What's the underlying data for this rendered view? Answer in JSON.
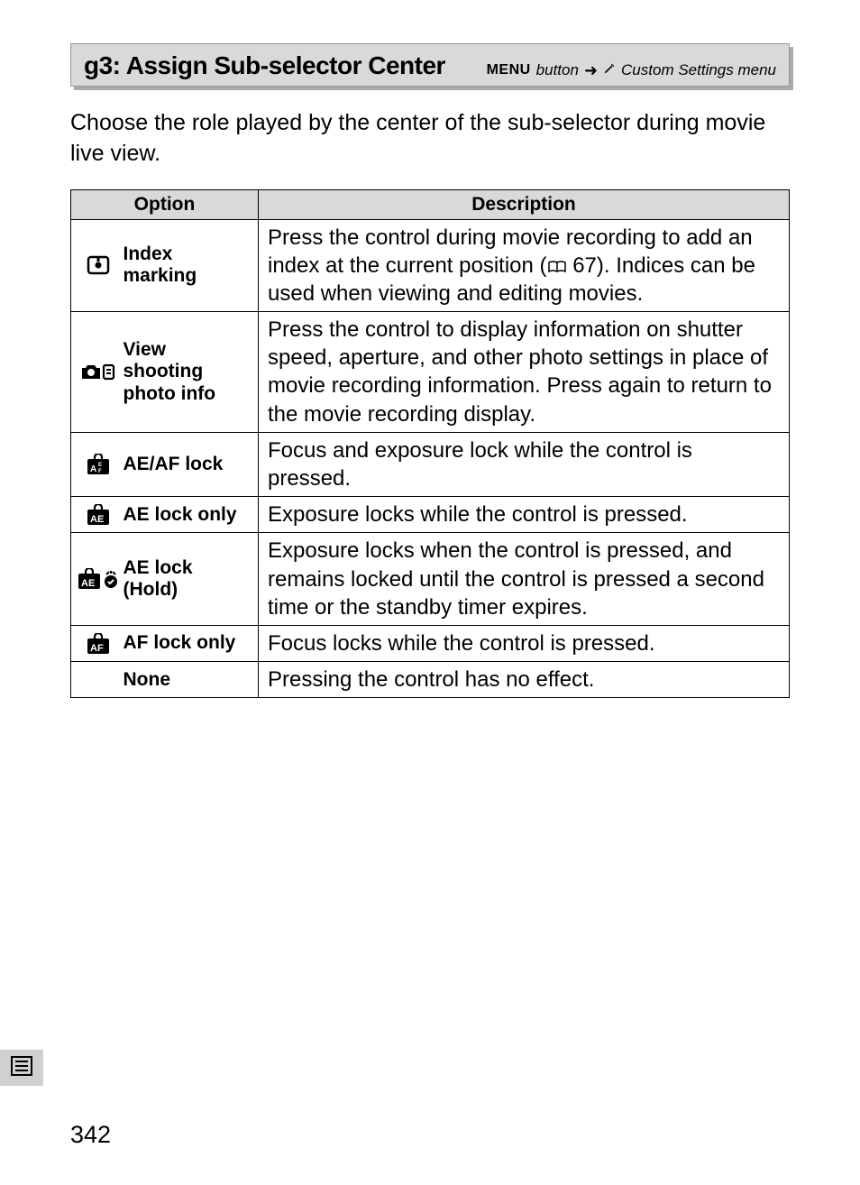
{
  "header": {
    "title": "g3: Assign Sub-selector Center",
    "menu_label": "MENU",
    "button_label": "button",
    "arrow": "➜",
    "menu_name": "Custom Settings menu"
  },
  "intro": "Choose the role played by the center of the sub-selector during movie live view.",
  "table": {
    "col_option": "Option",
    "col_description": "Description",
    "rows": [
      {
        "icon": "index-marking",
        "label": "Index marking",
        "desc_pre": "Press the control during movie recording to add an index at the current position (",
        "desc_ref": "67",
        "desc_post": ").  Indices can be used when viewing and editing movies."
      },
      {
        "icon": "camera-info",
        "label": "View shooting photo info",
        "desc": "Press the control to display information on shutter speed, aperture, and other photo settings in place of movie recording information.  Press again to return to the movie recording display."
      },
      {
        "icon": "ae-af-lock",
        "label": "AE/AF lock",
        "desc": "Focus and exposure lock while the control is pressed."
      },
      {
        "icon": "ae-lock",
        "label": "AE lock only",
        "desc": "Exposure locks while the control is pressed."
      },
      {
        "icon": "ae-lock-hold",
        "label": "AE lock (Hold)",
        "desc": "Exposure locks when the control is pressed, and remains locked until the control is pressed a second time or the standby timer expires."
      },
      {
        "icon": "af-lock",
        "label": "AF lock only",
        "desc": "Focus locks while the control is pressed."
      },
      {
        "icon": "",
        "label": "None",
        "desc": "Pressing the control has no effect."
      }
    ]
  },
  "page_number": "342"
}
